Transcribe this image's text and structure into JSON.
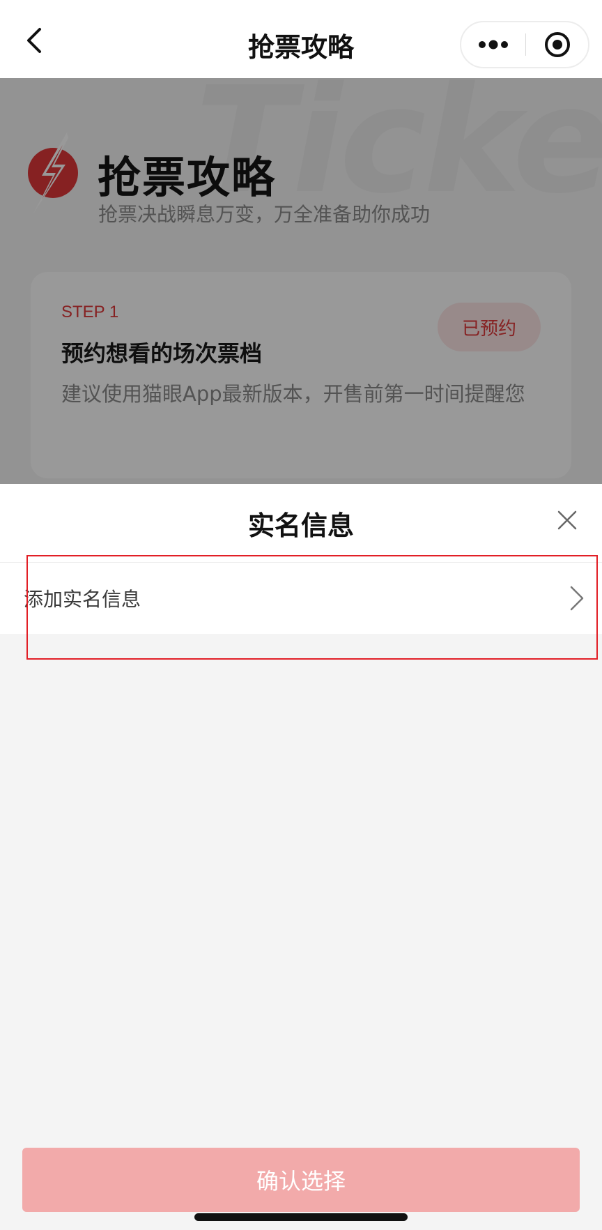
{
  "navbar": {
    "title": "抢票攻略",
    "back_icon": "chevron-left-icon",
    "more_icon": "more-dots-icon",
    "close_icon": "target-circle-icon"
  },
  "guide": {
    "watermark_text": "Ticket Tips",
    "title": "抢票攻略",
    "subtitle": "抢票决战瞬息万变，万全准备助你成功",
    "logo_icon": "lightning-bolt-icon",
    "step": {
      "label": "STEP 1",
      "title": "预约想看的场次票档",
      "description": "建议使用猫眼App最新版本，开售前第一时间提醒您",
      "status": "已预约"
    }
  },
  "sheet": {
    "title": "实名信息",
    "close_icon": "close-x-icon",
    "add_row_label": "添加实名信息",
    "add_row_icon": "chevron-right-icon",
    "confirm_label": "确认选择"
  },
  "colors": {
    "accent": "#e0383a",
    "confirm_disabled": "#f2aaaa",
    "highlight": "#e21f26"
  }
}
